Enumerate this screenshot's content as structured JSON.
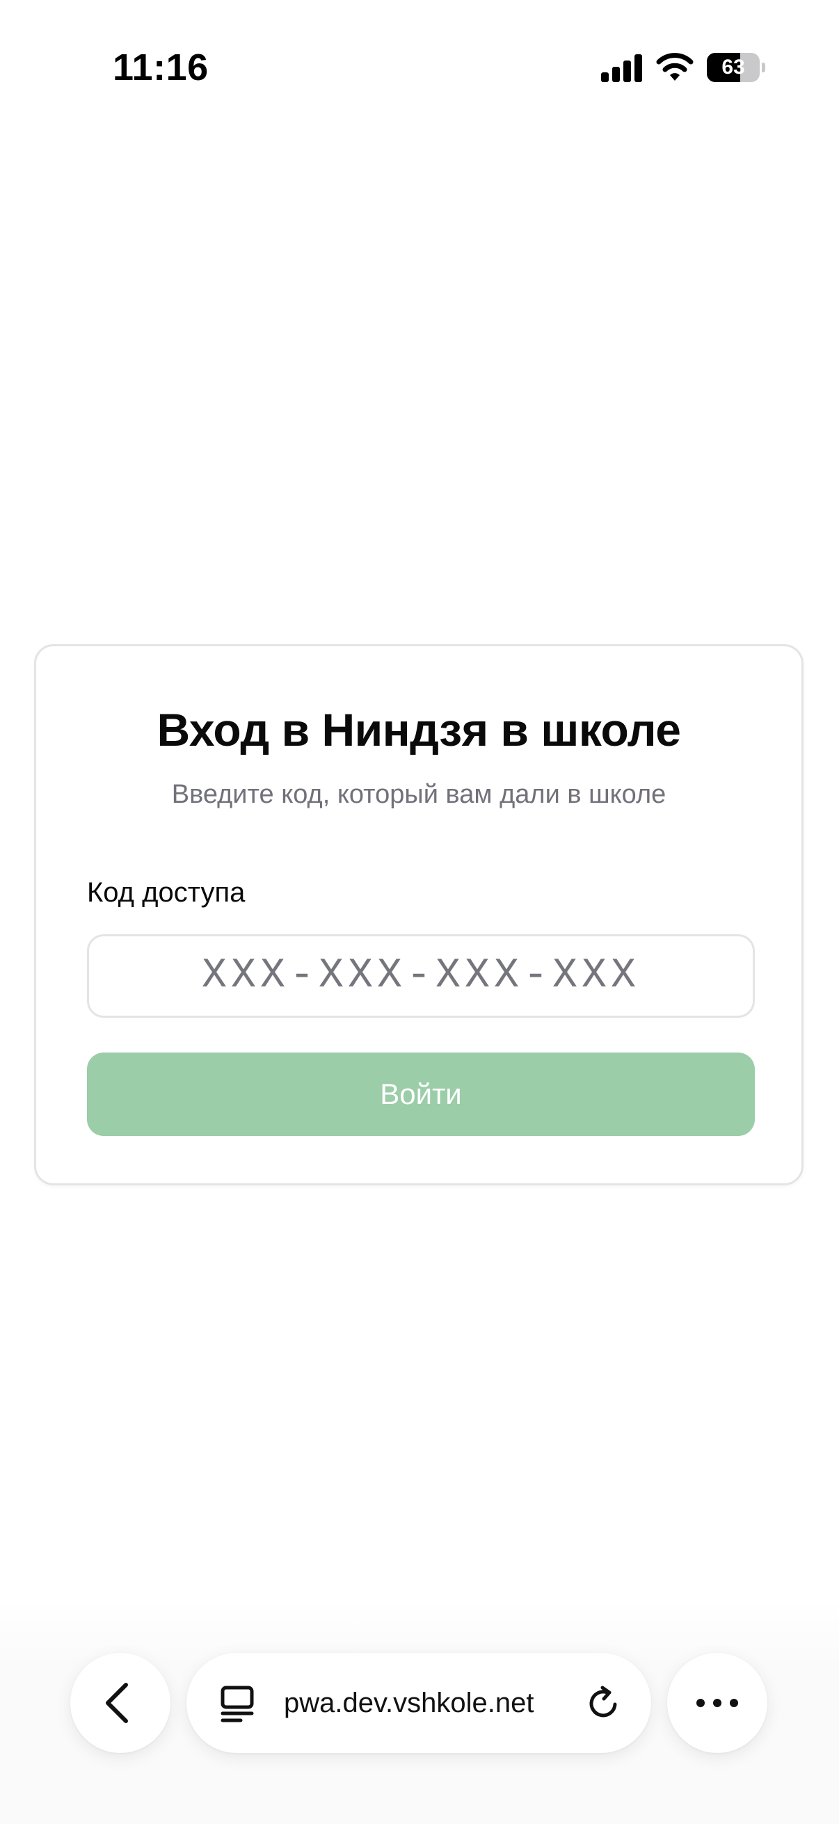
{
  "status_bar": {
    "time": "11:16",
    "battery_level": "63",
    "battery_fraction": 0.63,
    "icons": [
      "signal-icon",
      "wifi-icon",
      "battery-icon"
    ]
  },
  "login_card": {
    "title": "Вход в Ниндзя в школе",
    "subtitle": "Введите код, который вам дали в школе",
    "field_label": "Код доступа",
    "code_input": {
      "value": "",
      "placeholder": "XXX-XXX-XXX-XXX"
    },
    "submit_label": "Войти",
    "submit_color": "#9acda8"
  },
  "browser_toolbar": {
    "url": "pwa.dev.vshkole.net",
    "icons": [
      "back-icon",
      "page-menu-icon",
      "reload-icon",
      "more-icon"
    ]
  }
}
